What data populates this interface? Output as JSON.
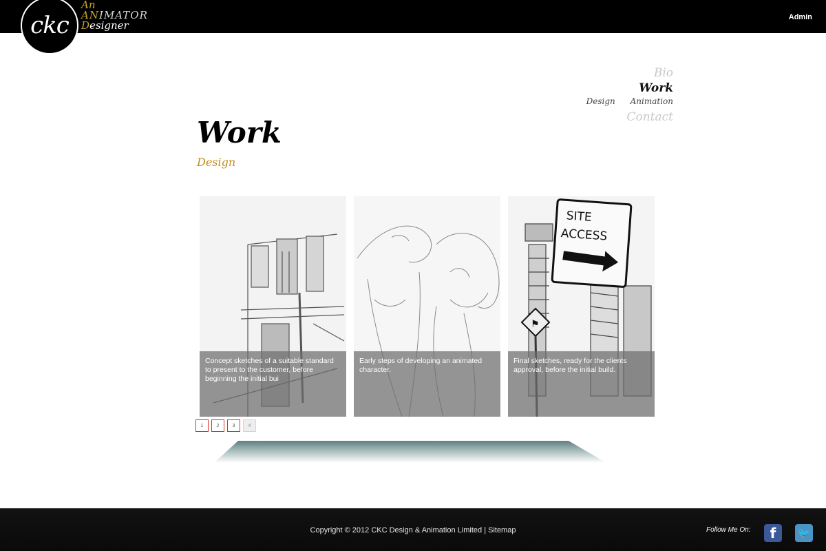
{
  "header": {
    "logo_text": "ckc",
    "tagline": {
      "line1": "An",
      "line2_prefix": "A",
      "line2_n": "N",
      "line2_rest": "IMATOR",
      "line3_prefix": "D",
      "line3_rest": "esigner"
    },
    "admin_label": "Admin"
  },
  "nav": {
    "bio": "Bio",
    "work": "Work",
    "sub": [
      "Design",
      "Animation"
    ],
    "contact": "Contact"
  },
  "page": {
    "title": "Work",
    "subtitle": "Design"
  },
  "gallery": {
    "items": [
      {
        "caption": "Concept sketches of a suitable standard to present to the customer, before beginning the initial bui"
      },
      {
        "caption": "Early steps of developing an animated character."
      },
      {
        "caption": "Final sketches, ready for the clients approval, before the initial build."
      }
    ],
    "sign_text": [
      "SITE",
      "ACCESS"
    ]
  },
  "pagination": {
    "pages": [
      "1",
      "2",
      "3",
      "4"
    ]
  },
  "footer": {
    "copyright": "Copyright © 2012 CKC Design & Animation Limited | Sitemap",
    "follow_label": "Follow Me On:",
    "colors": {
      "facebook": "#3b5998",
      "twitter": "#4a94c4"
    }
  }
}
